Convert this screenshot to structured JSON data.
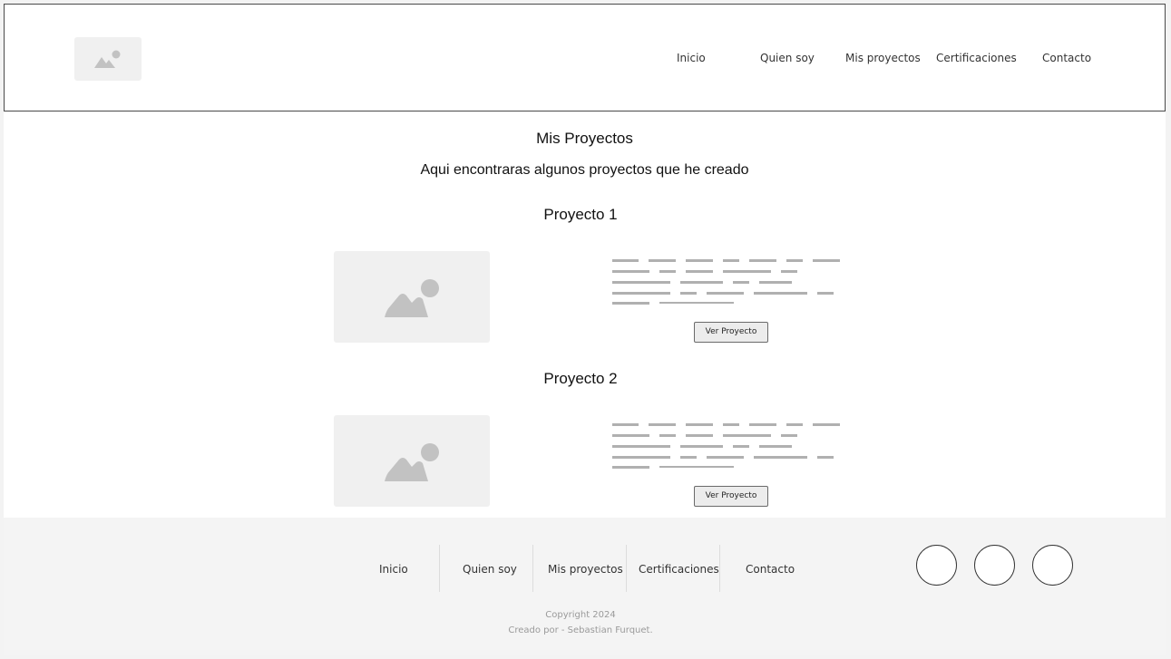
{
  "header": {
    "logo_icon": "image-placeholder-icon",
    "nav": [
      "Inicio",
      "Quien soy",
      "Mis proyectos",
      "Certificaciones",
      "Contacto"
    ]
  },
  "main": {
    "title": "Mis Proyectos",
    "subtitle": "Aqui encontraras algunos proyectos que he creado",
    "projects": [
      {
        "title": "Proyecto 1",
        "image_icon": "image-placeholder-icon",
        "button_label": "Ver Proyecto"
      },
      {
        "title": "Proyecto 2",
        "image_icon": "image-placeholder-icon",
        "button_label": "Ver Proyecto"
      }
    ]
  },
  "footer": {
    "nav": [
      "Inicio",
      "Quien soy",
      "Mis proyectos",
      "Certificaciones",
      "Contacto"
    ],
    "social_icons": [
      "social-circle-icon",
      "social-circle-icon",
      "social-circle-icon"
    ],
    "copyright": "Copyright 2024",
    "credit": "Creado por - Sebastian Furquet."
  },
  "colors": {
    "placeholder_bg": "#f0f0f0",
    "placeholder_fg": "#c2c2c2",
    "footer_bg": "#f4f4f4",
    "text_lines": "#b0b0b0"
  }
}
